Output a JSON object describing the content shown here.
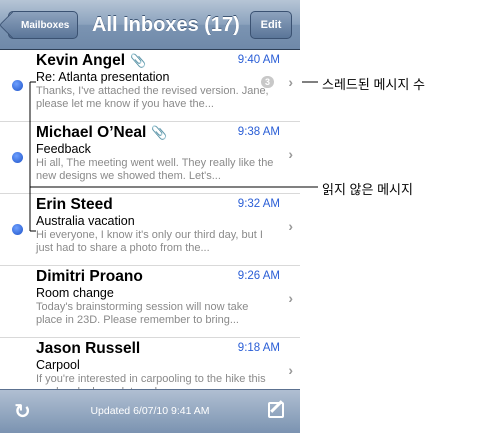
{
  "nav": {
    "back_label": "Mailboxes",
    "title": "All Inboxes (17)",
    "edit_label": "Edit"
  },
  "messages": [
    {
      "sender": "Kevin Angel",
      "time": "9:40 AM",
      "subject": "Re: Atlanta presentation",
      "preview": "Thanks, I've attached the revised version. Jane, please let me know if you have the...",
      "unread": true,
      "attachment": true,
      "thread_count": "3"
    },
    {
      "sender": "Michael O’Neal",
      "time": "9:38 AM",
      "subject": "Feedback",
      "preview": "Hi all, The meeting went well. They really like the new designs we showed them. Let's...",
      "unread": true,
      "attachment": true
    },
    {
      "sender": "Erin Steed",
      "time": "9:32 AM",
      "subject": "Australia vacation",
      "preview": "Hi everyone, I know it's only our third day, but I just had to share a photo from the...",
      "unread": true,
      "attachment": false
    },
    {
      "sender": "Dimitri Proano",
      "time": "9:26 AM",
      "subject": "Room change",
      "preview": "Today's brainstorming session will now take place in 23D. Please remember to bring...",
      "unread": false,
      "attachment": false
    },
    {
      "sender": "Jason Russell",
      "time": "9:18 AM",
      "subject": "Carpool",
      "preview": "If you're interested in carpooling to the hike this weekend, please let me know...",
      "unread": false,
      "attachment": false
    }
  ],
  "toolbar": {
    "updated": "Updated 6/07/10 9:41 AM",
    "refresh_icon": "refresh-icon",
    "compose_icon": "compose-icon"
  },
  "callouts": {
    "thread": "스레드된 메시지 수",
    "unread": "읽지 않은 메시지"
  },
  "colors": {
    "accent": "#2a5ed6",
    "unread_dot": "#1f54c9"
  }
}
